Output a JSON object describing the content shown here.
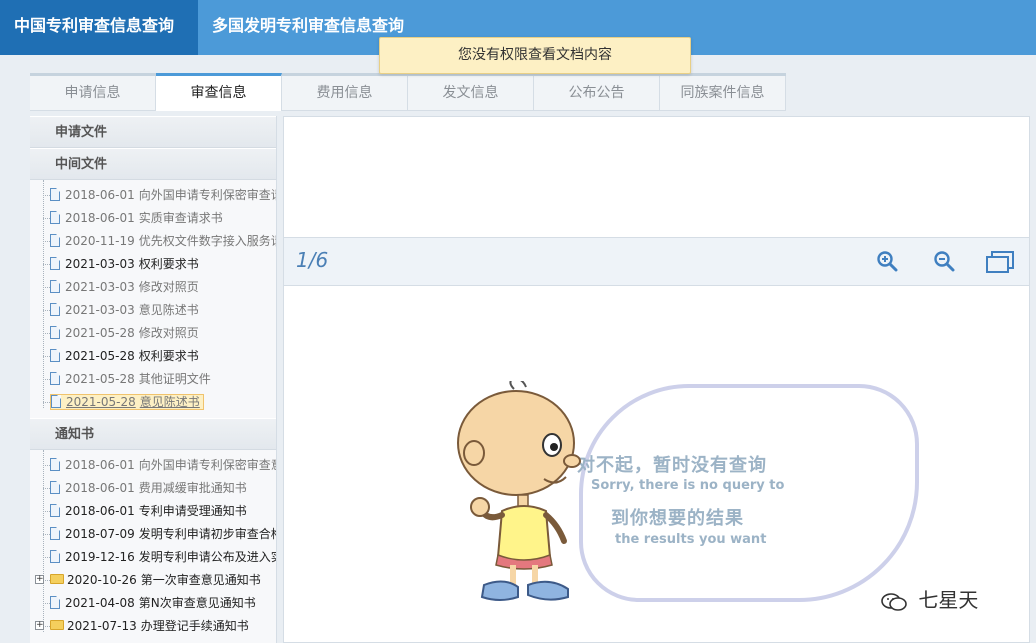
{
  "topbar": {
    "tab_cn": "中国专利审查信息查询",
    "tab_multi": "多国发明专利审查信息查询"
  },
  "toast": {
    "message": "您没有权限查看文档内容"
  },
  "subtabs": [
    {
      "label": "申请信息",
      "active": false
    },
    {
      "label": "审查信息",
      "active": true
    },
    {
      "label": "费用信息",
      "active": false
    },
    {
      "label": "发文信息",
      "active": false
    },
    {
      "label": "公布公告",
      "active": false
    },
    {
      "label": "同族案件信息",
      "active": false
    }
  ],
  "left": {
    "section_apply": "申请文件",
    "section_middle": "中间文件",
    "middle_items": [
      {
        "date": "2018-06-01",
        "name": "向外国申请专利保密审查请求书",
        "bold": false
      },
      {
        "date": "2018-06-01",
        "name": "实质审查请求书",
        "bold": false
      },
      {
        "date": "2020-11-19",
        "name": "优先权文件数字接入服务请求书",
        "bold": false
      },
      {
        "date": "2021-03-03",
        "name": "权利要求书",
        "bold": true
      },
      {
        "date": "2021-03-03",
        "name": "修改对照页",
        "bold": false
      },
      {
        "date": "2021-03-03",
        "name": "意见陈述书",
        "bold": false
      },
      {
        "date": "2021-05-28",
        "name": "修改对照页",
        "bold": false
      },
      {
        "date": "2021-05-28",
        "name": "权利要求书",
        "bold": true
      },
      {
        "date": "2021-05-28",
        "name": "其他证明文件",
        "bold": false
      },
      {
        "date": "2021-05-28",
        "name": "意见陈述书",
        "bold": false,
        "selected": true
      }
    ],
    "section_notice": "通知书",
    "notice_items": [
      {
        "date": "2018-06-01",
        "name": "向外国申请专利保密审查意见通知书",
        "bold": false
      },
      {
        "date": "2018-06-01",
        "name": "费用减缓审批通知书",
        "bold": false
      },
      {
        "date": "2018-06-01",
        "name": "专利申请受理通知书",
        "bold": true
      },
      {
        "date": "2018-07-09",
        "name": "发明专利申请初步审查合格通知书",
        "bold": true
      },
      {
        "date": "2019-12-16",
        "name": "发明专利申请公布及进入实质审查阶段通知书",
        "bold": true
      },
      {
        "date": "2020-10-26",
        "name": "第一次审查意见通知书",
        "bold": true,
        "folder": true
      },
      {
        "date": "2021-04-08",
        "name": "第N次审查意见通知书",
        "bold": true
      },
      {
        "date": "2021-07-13",
        "name": "办理登记手续通知书",
        "bold": true,
        "folder": true
      }
    ]
  },
  "viewer": {
    "page_counter": "1/6",
    "sorry_cn1": "对不起，暂时没有查询",
    "sorry_en1": "Sorry, there is no query to",
    "sorry_cn2": "到你想要的结果",
    "sorry_en2": "the results you want"
  },
  "watermark": {
    "text": "七星天"
  }
}
